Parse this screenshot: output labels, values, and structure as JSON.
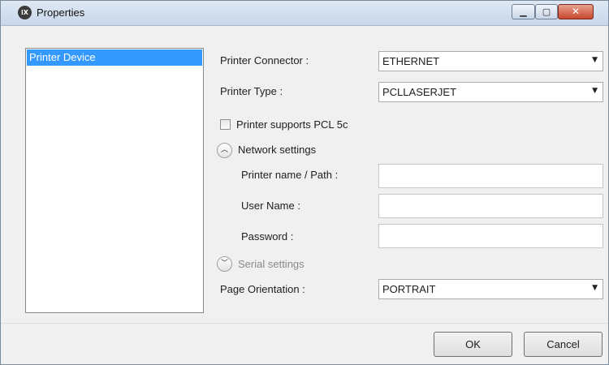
{
  "window": {
    "title": "Properties",
    "app_icon_text": "iX",
    "minimize_glyph": "▁",
    "maximize_glyph": "▢",
    "close_glyph": "✕"
  },
  "sidebar": {
    "items": [
      {
        "label": "Printer Device",
        "selected": true
      }
    ]
  },
  "form": {
    "printer_connector": {
      "label": "Printer Connector :",
      "value": "ETHERNET"
    },
    "printer_type": {
      "label": "Printer Type :",
      "value": "PCLLASERJET"
    },
    "pcl5c": {
      "label": "Printer supports PCL 5c",
      "checked": false
    },
    "network_settings": {
      "label": "Network settings",
      "expanded": true,
      "expander_glyph": "︿",
      "printer_name": {
        "label": "Printer name / Path :",
        "value": ""
      },
      "user_name": {
        "label": "User Name :",
        "value": ""
      },
      "password": {
        "label": "Password :",
        "value": ""
      }
    },
    "serial_settings": {
      "label": "Serial settings",
      "expanded": false,
      "expander_glyph": "﹀"
    },
    "page_orientation": {
      "label": "Page Orientation :",
      "value": "PORTRAIT"
    },
    "dropdown_arrow": "▼"
  },
  "buttons": {
    "ok": "OK",
    "cancel": "Cancel"
  },
  "colors": {
    "selection": "#3399ff",
    "window_bg": "#f0f0f0",
    "close_button": "#c7472d"
  }
}
